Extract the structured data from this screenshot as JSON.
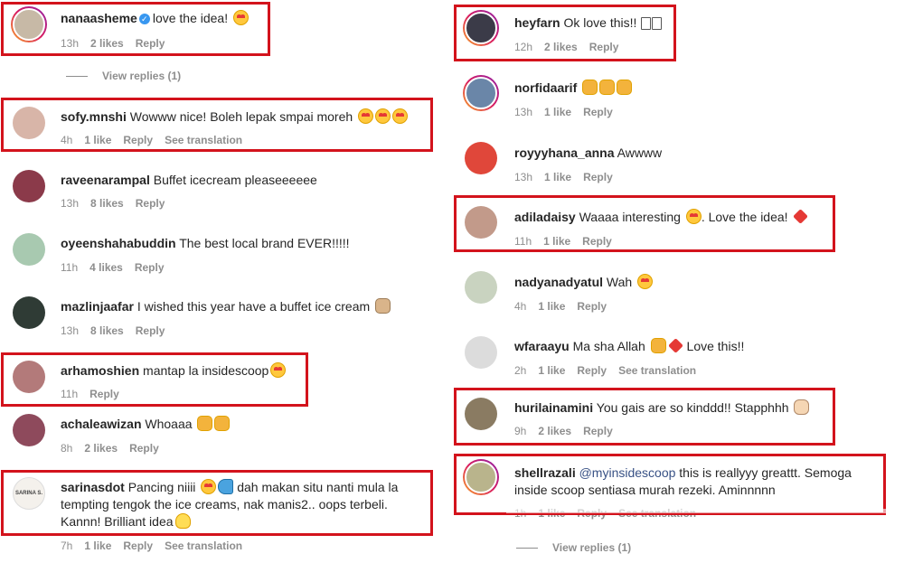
{
  "left_comments": [
    {
      "username": "nanaasheme",
      "verified": true,
      "text": "love the idea!",
      "emoji": [
        "heart-eyes"
      ],
      "time": "13h",
      "likes": "2 likes",
      "reply": "Reply",
      "translation": "",
      "avatar_color": "#c7b9a6",
      "ring": true,
      "view_replies": "View replies (1)"
    },
    {
      "username": "sofy.mnshi",
      "text": "Wowww nice! Boleh lepak smpai moreh",
      "emoji": [
        "heart-eyes",
        "heart-eyes",
        "heart-eyes"
      ],
      "time": "4h",
      "likes": "1 like",
      "reply": "Reply",
      "translation": "See translation",
      "avatar_color": "#d8b5a8"
    },
    {
      "username": "raveenarampal",
      "text": "Buffet icecream pleaseeeeee",
      "emoji": [],
      "time": "13h",
      "likes": "8 likes",
      "reply": "Reply",
      "translation": "",
      "avatar_color": "#8b3a4a"
    },
    {
      "username": "oyeenshahabuddin",
      "text": "The best local brand EVER!!!!!",
      "emoji": [],
      "time": "11h",
      "likes": "4 likes",
      "reply": "Reply",
      "translation": "",
      "avatar_color": "#a8c9b0"
    },
    {
      "username": "mazlinjaafar",
      "text": "I wished this year have a buffet ice cream",
      "emoji": [
        "pray"
      ],
      "time": "13h",
      "likes": "8 likes",
      "reply": "Reply",
      "translation": "",
      "avatar_color": "#2f3b35"
    },
    {
      "username": "arhamoshien",
      "text": "mantap la insidescoop",
      "emoji": [
        "heart-eyes"
      ],
      "time": "11h",
      "likes": "",
      "reply": "Reply",
      "translation": "",
      "avatar_color": "#b37a7a"
    },
    {
      "username": "achaleawizan",
      "text": "Whoaaa",
      "emoji": [
        "hands",
        "hands"
      ],
      "time": "8h",
      "likes": "2 likes",
      "reply": "Reply",
      "translation": "",
      "avatar_color": "#8e4a5c"
    },
    {
      "username": "sarinasdot",
      "text": "Pancing niiii",
      "text_after": "dah makan situ nanti mula la tempting tengok the ice creams, nak manis2.. oops terbeli. Kannn! Brilliant idea",
      "emoji": [
        "heart-eyes",
        "fish"
      ],
      "end_emoji": [
        "bulb"
      ],
      "time": "7h",
      "likes": "1 like",
      "reply": "Reply",
      "translation": "See translation",
      "avatar_color": "#f4f1ec",
      "avatar_text": "SARINA S."
    }
  ],
  "right_comments": [
    {
      "username": "heyfarn",
      "text": "Ok love this!!",
      "emoji": [
        "box",
        "box"
      ],
      "time": "12h",
      "likes": "2 likes",
      "reply": "Reply",
      "translation": "",
      "avatar_color": "#3b3b48",
      "ring": true
    },
    {
      "username": "norfidaarif",
      "text": "",
      "emoji": [
        "hands",
        "hands",
        "hands"
      ],
      "time": "13h",
      "likes": "1 like",
      "reply": "Reply",
      "translation": "",
      "avatar_color": "#6a86a8",
      "ring": true
    },
    {
      "username": "royyyhana_anna",
      "text": "Awwww",
      "emoji": [],
      "time": "13h",
      "likes": "1 like",
      "reply": "Reply",
      "translation": "",
      "avatar_color": "#e0473a"
    },
    {
      "username": "adiladaisy",
      "text": "Waaaa interesting",
      "text_after": ". Love the idea!",
      "emoji": [
        "heart-eyes"
      ],
      "end_emoji": [
        "heart"
      ],
      "time": "11h",
      "likes": "1 like",
      "reply": "Reply",
      "translation": "",
      "avatar_color": "#c29a8a"
    },
    {
      "username": "nadyanadyatul",
      "text": "Wah",
      "emoji": [
        "heart-eyes"
      ],
      "time": "4h",
      "likes": "1 like",
      "reply": "Reply",
      "translation": "",
      "avatar_color": "#c9d3c0"
    },
    {
      "username": "wfaraayu",
      "text": "Ma sha Allah",
      "text_after": "Love this!!",
      "emoji": [
        "hands",
        "heart"
      ],
      "time": "2h",
      "likes": "1 like",
      "reply": "Reply",
      "translation": "See translation",
      "avatar_color": "#dcdcdc"
    },
    {
      "username": "hurilainamini",
      "text": "You gais are so kinddd!! Stapphhh",
      "emoji": [
        "hand"
      ],
      "time": "9h",
      "likes": "2 likes",
      "reply": "Reply",
      "translation": "",
      "avatar_color": "#8a7b62"
    },
    {
      "username": "shellrazali",
      "mention": "@myinsidescoop",
      "text": "this is reallyyy greattt. Semoga inside scoop sentiasa murah rezeki. Aminnnnn",
      "emoji": [],
      "time": "1h",
      "likes": "1 like",
      "reply": "Reply",
      "translation": "See translation",
      "avatar_color": "#b9b48c",
      "ring": true,
      "view_replies": "View replies (1)"
    }
  ]
}
